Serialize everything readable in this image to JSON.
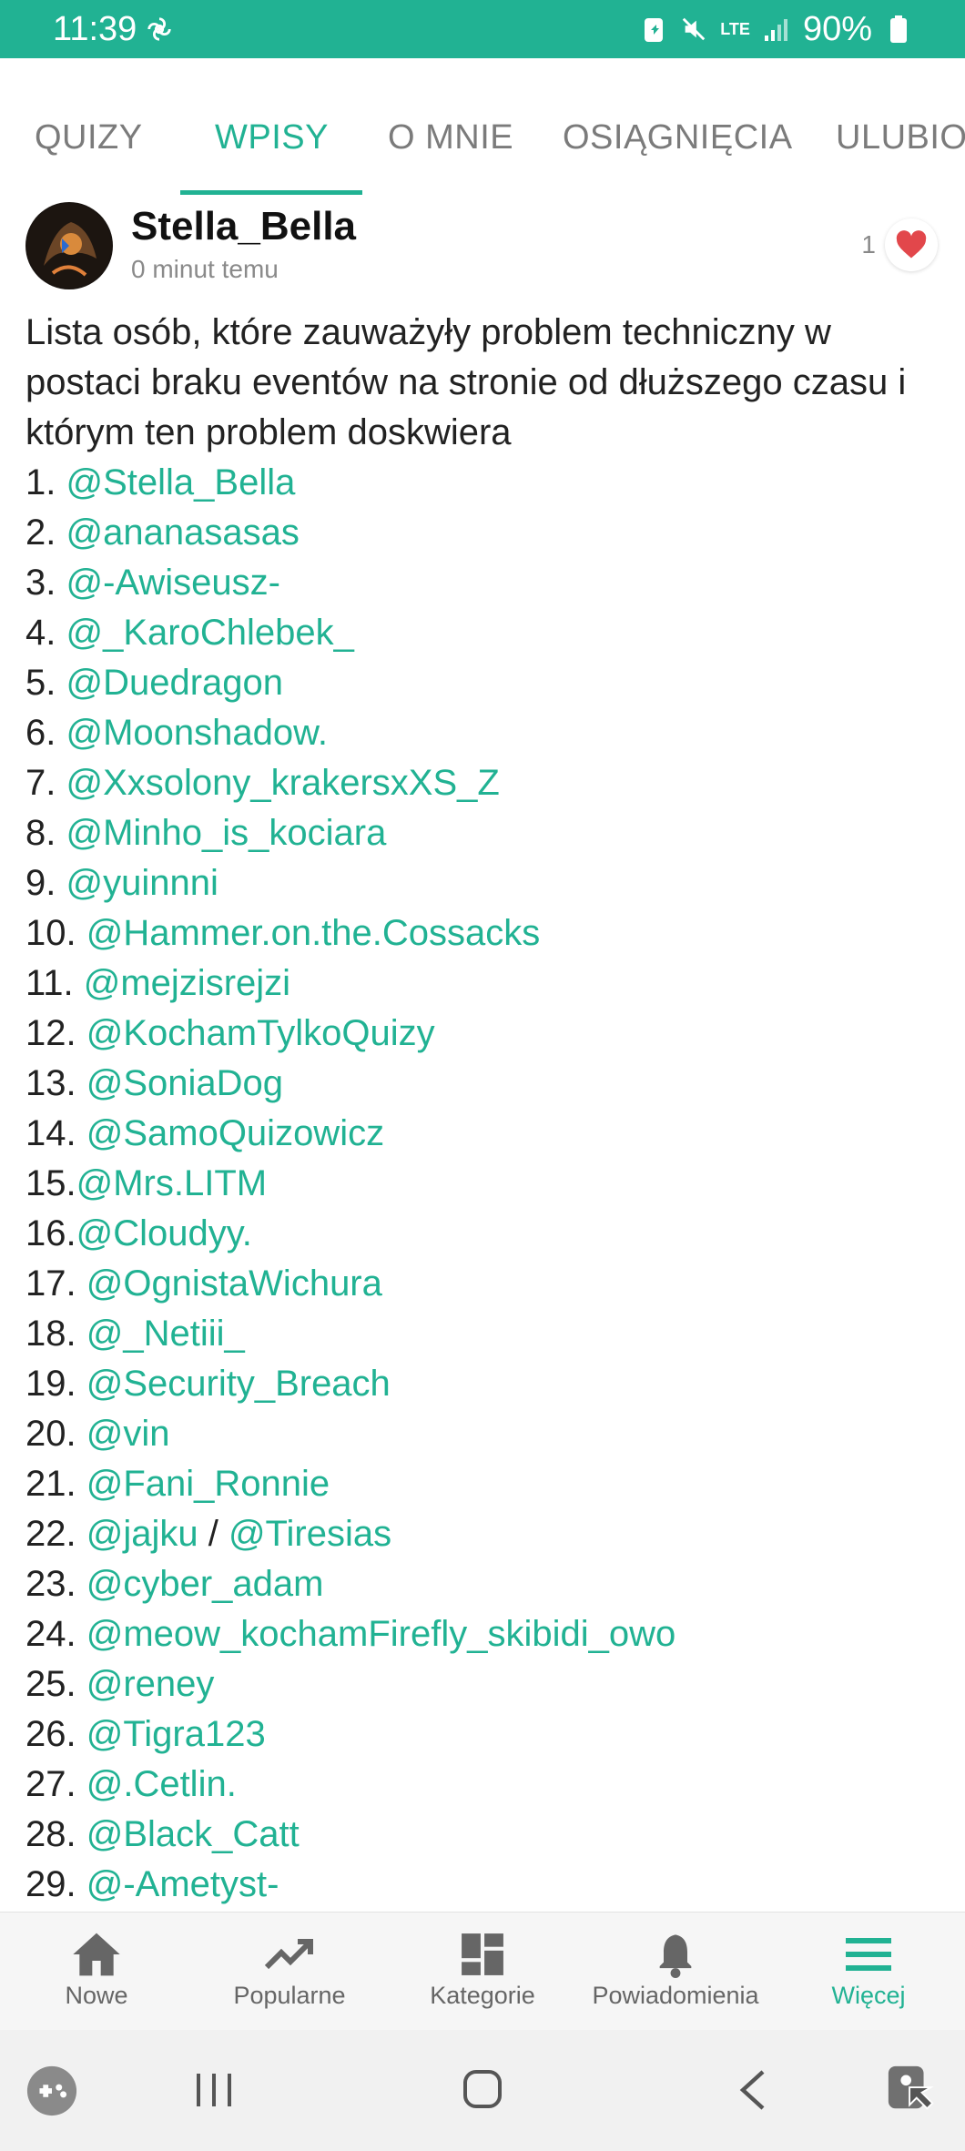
{
  "status": {
    "time": "11:39",
    "battery": "90%",
    "network": "LTE"
  },
  "tabs": [
    "QUIZY",
    "WPISY",
    "O MNIE",
    "OSIĄGNIĘCIA",
    "ULUBIO"
  ],
  "active_tab": "WPISY",
  "post": {
    "author": "Stella_Bella",
    "time_ago": "0 minut temu",
    "likes": "1",
    "text": "Lista osób, które zauważyły problem techniczny w postaci braku eventów na stronie od dłuższego czasu i którym ten problem doskwiera",
    "list": [
      {
        "num": "1. ",
        "mentions": [
          "@Stella_Bella"
        ]
      },
      {
        "num": "2. ",
        "mentions": [
          "@ananasasas"
        ]
      },
      {
        "num": "3. ",
        "mentions": [
          "@-Awiseusz-"
        ]
      },
      {
        "num": "4. ",
        "mentions": [
          "@_KaroChlebek_"
        ]
      },
      {
        "num": "5. ",
        "mentions": [
          "@Duedragon"
        ]
      },
      {
        "num": "6. ",
        "mentions": [
          "@Moonshadow."
        ]
      },
      {
        "num": "7. ",
        "mentions": [
          "@Xxsolony_krakersxXS_Z"
        ]
      },
      {
        "num": "8. ",
        "mentions": [
          "@Minho_is_kociara"
        ]
      },
      {
        "num": "9. ",
        "mentions": [
          "@yuinnni"
        ]
      },
      {
        "num": "10. ",
        "mentions": [
          "@Hammer.on.the.Cossacks"
        ]
      },
      {
        "num": "11. ",
        "mentions": [
          "@mejzisrejzi"
        ]
      },
      {
        "num": "12. ",
        "mentions": [
          "@KochamTylkoQuizy"
        ]
      },
      {
        "num": "13. ",
        "mentions": [
          "@SoniaDog"
        ]
      },
      {
        "num": "14. ",
        "mentions": [
          "@SamoQuizowicz"
        ]
      },
      {
        "num": "15.",
        "mentions": [
          "@Mrs.LITM"
        ]
      },
      {
        "num": "16.",
        "mentions": [
          "@Cloudyy."
        ]
      },
      {
        "num": "17. ",
        "mentions": [
          "@OgnistaWichura"
        ]
      },
      {
        "num": "18. ",
        "mentions": [
          "@_Netiii_"
        ]
      },
      {
        "num": "19. ",
        "mentions": [
          "@Security_Breach"
        ]
      },
      {
        "num": "20. ",
        "mentions": [
          "@vin"
        ]
      },
      {
        "num": "21. ",
        "mentions": [
          "@Fani_Ronnie"
        ]
      },
      {
        "num": "22. ",
        "mentions": [
          "@jajku",
          "@Tiresias"
        ]
      },
      {
        "num": "23. ",
        "mentions": [
          "@cyber_adam"
        ]
      },
      {
        "num": "24. ",
        "mentions": [
          "@meow_kochamFirefly_skibidi_owo"
        ]
      },
      {
        "num": "25. ",
        "mentions": [
          "@reney"
        ]
      },
      {
        "num": "26. ",
        "mentions": [
          "@Tigra123"
        ]
      },
      {
        "num": "27. ",
        "mentions": [
          "@.Cetlin."
        ]
      },
      {
        "num": "28. ",
        "mentions": [
          "@Black_Catt"
        ]
      },
      {
        "num": "29. ",
        "mentions": [
          "@-Ametyst-"
        ]
      }
    ],
    "separator": " / "
  },
  "bottom_nav": [
    {
      "label": "Nowe",
      "icon": "home-icon"
    },
    {
      "label": "Popularne",
      "icon": "trending-icon"
    },
    {
      "label": "Kategorie",
      "icon": "dashboard-icon"
    },
    {
      "label": "Powiadomienia",
      "icon": "bell-icon"
    },
    {
      "label": "Więcej",
      "icon": "menu-icon"
    }
  ],
  "active_nav": "Więcej",
  "colors": {
    "accent": "#21b293",
    "heart": "#e2474b"
  }
}
